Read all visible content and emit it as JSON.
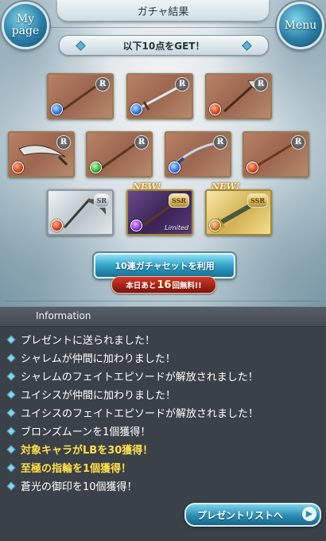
{
  "header": {
    "title": "ガチャ結果",
    "mypage_line1": "My",
    "mypage_line2": "page",
    "menu_label": "Menu"
  },
  "banner": {
    "text": "以下10点をGET！"
  },
  "items": [
    {
      "rarity": "R",
      "element": "water",
      "weapon": "staff",
      "is_new": false
    },
    {
      "rarity": "R",
      "element": "water",
      "weapon": "sword",
      "is_new": false
    },
    {
      "rarity": "R",
      "element": "fire",
      "weapon": "axe",
      "is_new": false
    },
    {
      "rarity": "R",
      "element": "fire",
      "weapon": "scimitar",
      "is_new": false
    },
    {
      "rarity": "R",
      "element": "wind",
      "weapon": "staff",
      "is_new": false
    },
    {
      "rarity": "R",
      "element": "water",
      "weapon": "katana",
      "is_new": false
    },
    {
      "rarity": "R",
      "element": "fire",
      "weapon": "spear",
      "is_new": false
    },
    {
      "rarity": "SR",
      "element": "fire",
      "weapon": "scythe",
      "is_new": false
    },
    {
      "rarity": "SSR",
      "element": "dark",
      "weapon": "staff",
      "is_new": true,
      "tag": "Limited"
    },
    {
      "rarity": "SSR",
      "element": "earth",
      "weapon": "greatsword",
      "is_new": true
    }
  ],
  "labels": {
    "new": "NEW!",
    "rarity_r": "R",
    "rarity_sr": "SR",
    "rarity_ssr": "SSR",
    "limited": "Limited"
  },
  "pull": {
    "button_label": "10連ガチャセットを利用",
    "free_prefix": "本日あと",
    "free_count": "16",
    "free_suffix": "回無料!!"
  },
  "information": {
    "heading": "Information",
    "entries": [
      {
        "text": "プレゼントに送られました！",
        "highlight": false
      },
      {
        "text": "シャレムが仲間に加わりました！",
        "highlight": false
      },
      {
        "text": "シャレムのフェイトエピソードが解放されました！",
        "highlight": false
      },
      {
        "text": "ユイシスが仲間に加わりました！",
        "highlight": false
      },
      {
        "text": "ユイシスのフェイトエピソードが解放されました！",
        "highlight": false
      },
      {
        "text": "ブロンズムーンを1個獲得！",
        "highlight": false
      },
      {
        "text": "対象キャラがLBを30獲得！",
        "highlight": true
      },
      {
        "text": "至極の指輪を1個獲得！",
        "highlight": true
      },
      {
        "text": "蒼光の御印を10個獲得！",
        "highlight": false
      }
    ],
    "present_button": "プレゼントリストへ"
  },
  "colors": {
    "accent": "#2fa3c8",
    "highlight_text": "#ffe04a",
    "info_bg": "#3b4148",
    "free_pill": "#b52a1c"
  }
}
